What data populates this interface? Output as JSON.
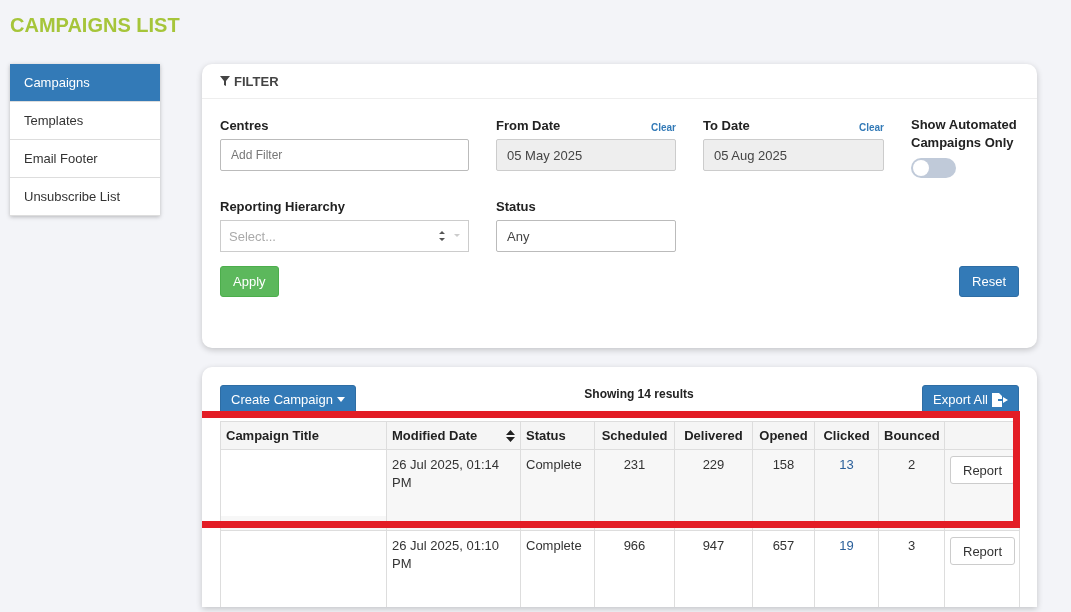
{
  "page_title": "CAMPAIGNS LIST",
  "sidebar": {
    "items": [
      {
        "label": "Campaigns",
        "selected": true
      },
      {
        "label": "Templates",
        "selected": false
      },
      {
        "label": "Email Footer",
        "selected": false
      },
      {
        "label": "Unsubscribe List",
        "selected": false
      }
    ]
  },
  "filter": {
    "title": "FILTER",
    "centres": {
      "label": "Centres",
      "placeholder": "Add Filter"
    },
    "from_date": {
      "label": "From Date",
      "clear": "Clear",
      "value": "05 May 2025"
    },
    "to_date": {
      "label": "To Date",
      "clear": "Clear",
      "value": "05 Aug 2025"
    },
    "automated": {
      "label": "Show Automated Campaigns Only",
      "on": false
    },
    "hierarchy": {
      "label": "Reporting Hierarchy",
      "placeholder": "Select..."
    },
    "status": {
      "label": "Status",
      "value": "Any"
    },
    "apply": "Apply",
    "reset": "Reset"
  },
  "results": {
    "create_button": "Create Campaign",
    "summary": "Showing 14 results",
    "export_button": "Export All",
    "columns": [
      "Campaign Title",
      "Modified Date",
      "Status",
      "Scheduled",
      "Delivered",
      "Opened",
      "Clicked",
      "Bounced"
    ],
    "rows": [
      {
        "modified": "26 Jul 2025, 01:14 PM",
        "status": "Complete",
        "scheduled": "231",
        "delivered": "229",
        "opened": "158",
        "clicked": "13",
        "bounced": "2",
        "action": "Report"
      },
      {
        "modified": "26 Jul 2025, 01:10 PM",
        "status": "Complete",
        "scheduled": "966",
        "delivered": "947",
        "opened": "657",
        "clicked": "19",
        "bounced": "3",
        "action": "Report"
      }
    ]
  }
}
